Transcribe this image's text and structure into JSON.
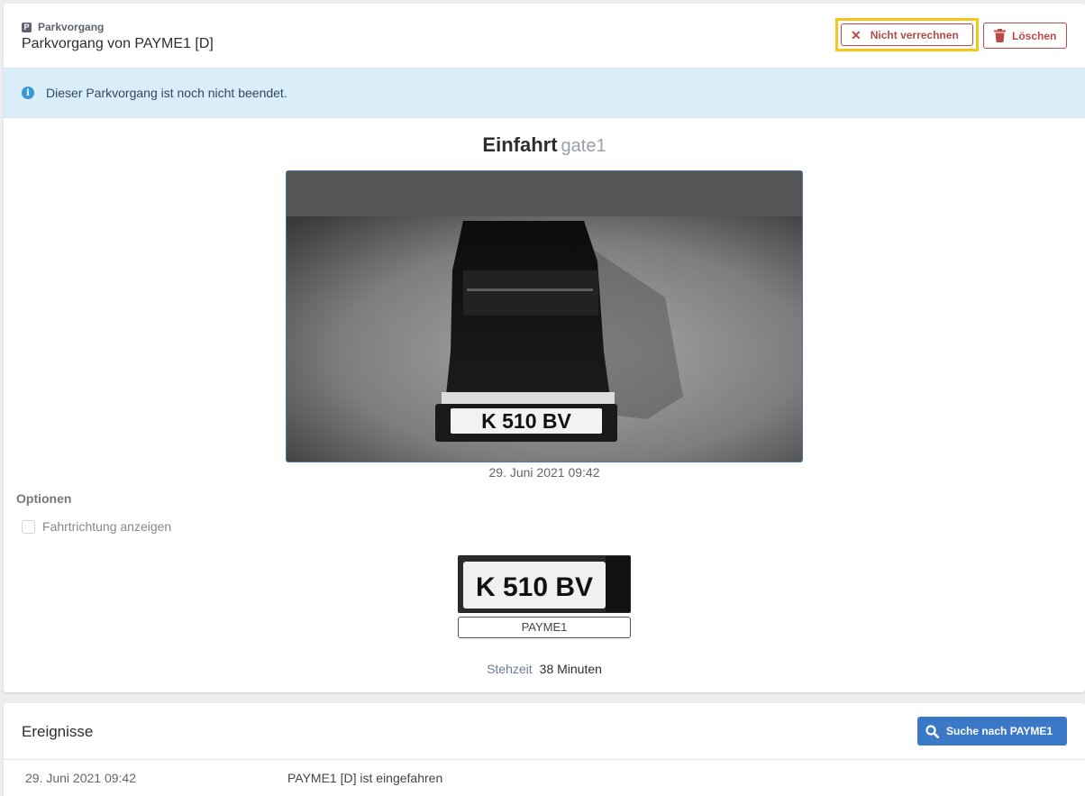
{
  "header": {
    "crumb_label": "Parkvorgang",
    "crumb_icon": "parking-icon",
    "title": "Parkvorgang von PAYME1 [D]",
    "nicht_verrechnen_label": "Nicht verrechnen",
    "loeschen_label": "Löschen"
  },
  "alert": {
    "message": "Dieser Parkvorgang ist noch nicht beendet.",
    "icon": "info-icon"
  },
  "entry": {
    "heading": "Einfahrt",
    "gate": "gate1",
    "timestamp": "29. Juni 2021 09:42",
    "photo_plate": "K 510 BV"
  },
  "options": {
    "title": "Optionen",
    "fahrtrichtung_label": "Fahrtrichtung anzeigen",
    "fahrtrichtung_checked": false
  },
  "plate": {
    "crop_text": "K 510 BV",
    "recognized": "PAYME1"
  },
  "stehzeit": {
    "label": "Stehzeit",
    "value": "38 Minuten"
  },
  "events": {
    "title": "Ereignisse",
    "search_label": "Suche nach PAYME1",
    "rows": [
      {
        "time": "29. Juni 2021 09:42",
        "text": "PAYME1 [D] ist eingefahren"
      }
    ]
  },
  "colors": {
    "danger": "#b94a48",
    "highlight": "#f5c518",
    "primary": "#3c78c8",
    "alert_bg": "#daeefa"
  }
}
